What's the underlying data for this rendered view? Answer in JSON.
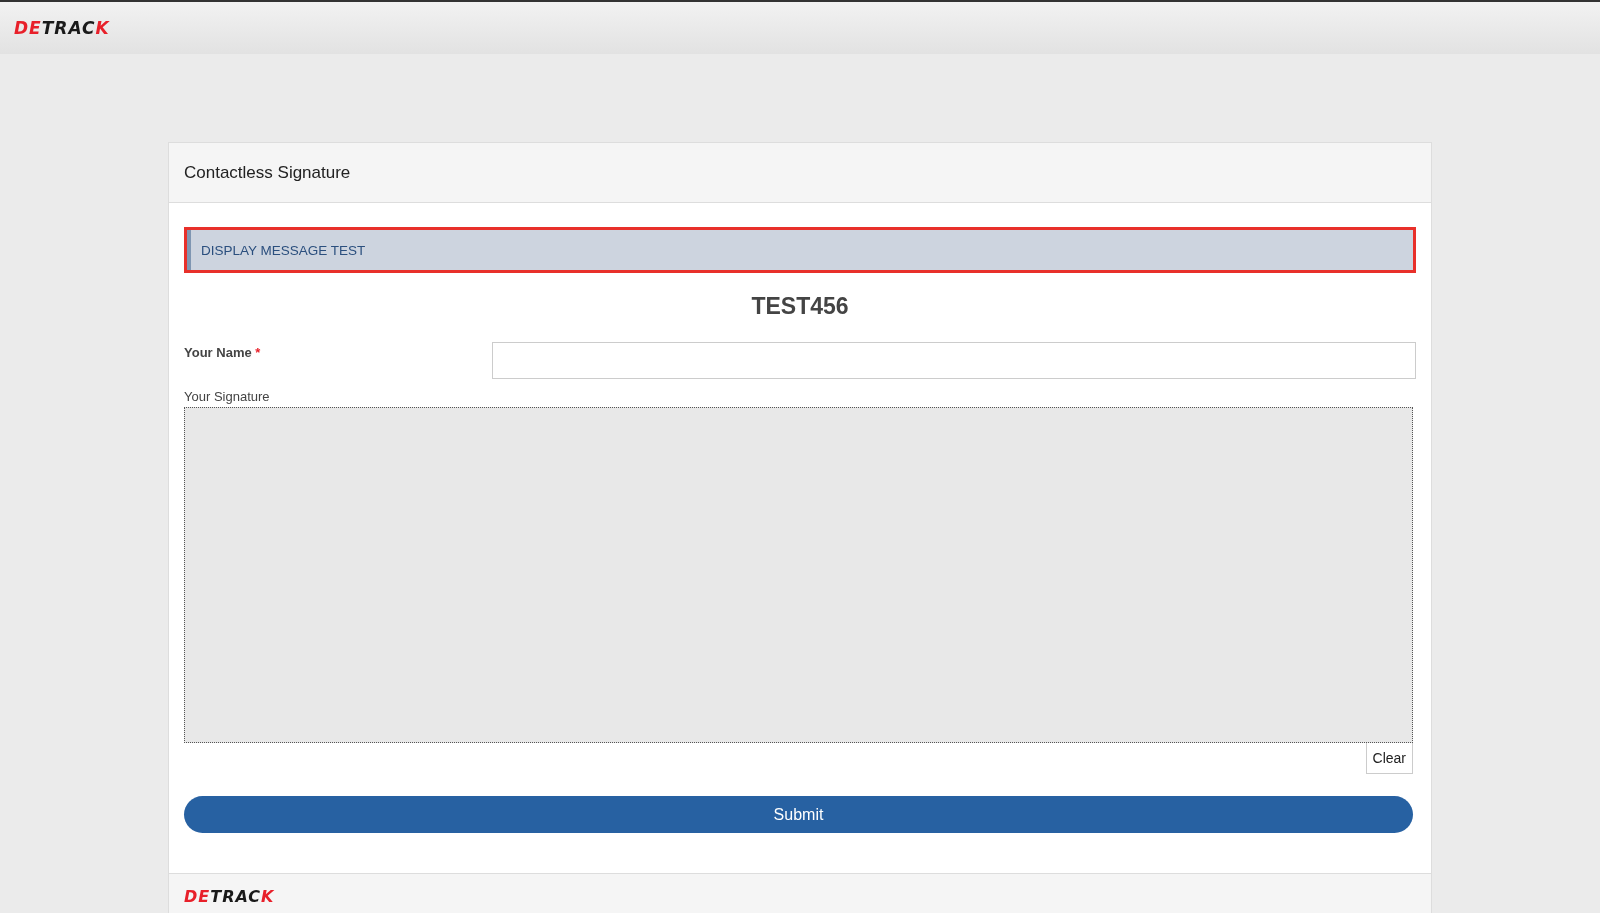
{
  "header": {
    "logo": [
      {
        "text": "DE",
        "color": "#e8202a"
      },
      {
        "text": "TRAC",
        "color": "#1a1a1a"
      },
      {
        "text": "K",
        "color": "#e8202a"
      }
    ]
  },
  "card": {
    "title": "Contactless Signature",
    "message": "DISPLAY MESSAGE TEST",
    "heading": "TEST456",
    "name_field": {
      "label": "Your Name",
      "required_mark": "*"
    },
    "signature": {
      "label": "Your Signature",
      "clear_button": "Clear"
    },
    "submit_button": "Submit",
    "footer_logo": [
      {
        "text": "DE",
        "color": "#e8202a"
      },
      {
        "text": "TRAC",
        "color": "#1a1a1a"
      },
      {
        "text": "K",
        "color": "#e8202a"
      }
    ]
  }
}
